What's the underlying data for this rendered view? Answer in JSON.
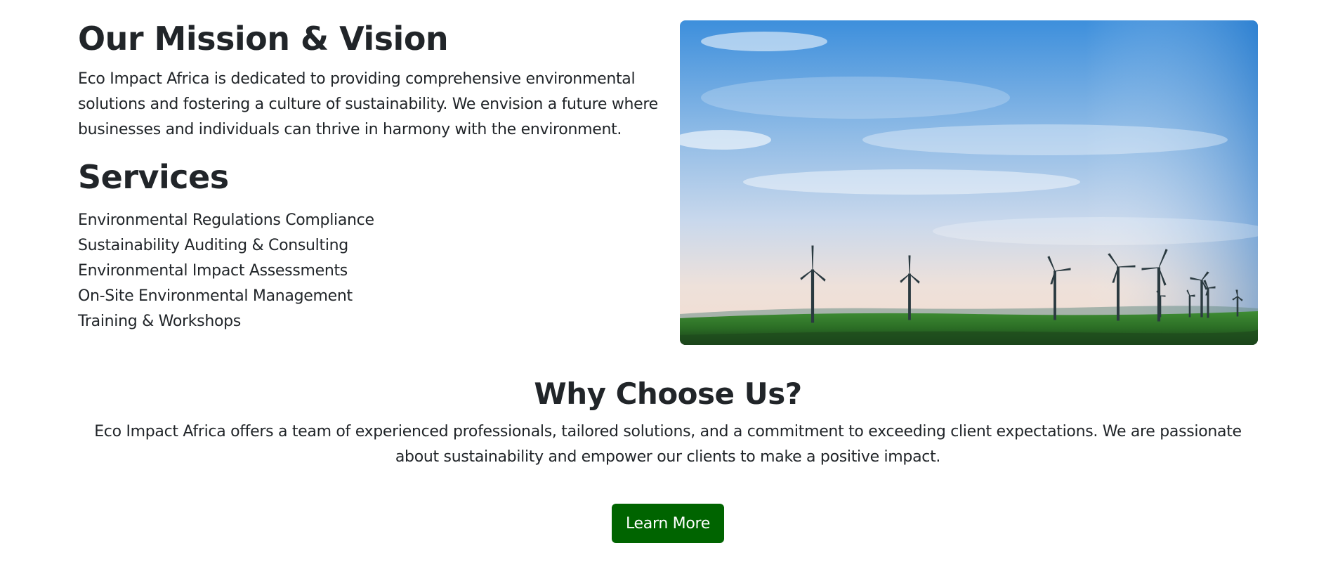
{
  "mission": {
    "title": "Our Mission & Vision",
    "text": "Eco Impact Africa is dedicated to providing comprehensive environmental solutions and fostering a culture of sustainability. We envision a future where businesses and individuals can thrive in harmony with the environment."
  },
  "services": {
    "title": "Services",
    "items": [
      "Environmental Regulations Compliance",
      "Sustainability Auditing & Consulting",
      "Environmental Impact Assessments",
      "On-Site Environmental Management",
      "Training & Workshops"
    ]
  },
  "hero_image": {
    "subject": "wind-turbines-landscape"
  },
  "why": {
    "title": "Why Choose Us?",
    "text": "Eco Impact Africa offers a team of experienced professionals, tailored solutions, and a commitment to exceeding client expectations. We are passionate about sustainability and empower our clients to make a positive impact."
  },
  "cta": {
    "label": "Learn More",
    "color": "#006400"
  },
  "colors": {
    "text": "#212529",
    "sky_top": "#2f86d6",
    "sky_bottom": "#f3e3d8",
    "field": "#2f7d2a"
  }
}
